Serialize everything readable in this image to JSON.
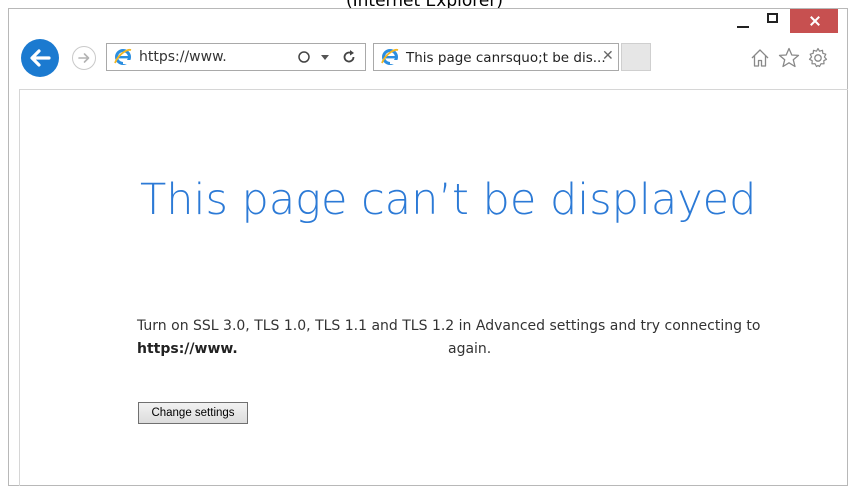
{
  "caption": "(Internet Explorer)",
  "toolbar": {
    "address_url": "https://www.",
    "tab_title": "This page canrsquo;t be dis...",
    "tab_close_glyph": "✕"
  },
  "page": {
    "heading": "This page can’t be displayed",
    "message_line1": "Turn on SSL 3.0, TLS 1.0, TLS 1.1 and TLS 1.2 in Advanced settings and try connecting to",
    "message_url": "https://www.",
    "message_line2_suffix": "again.",
    "settings_button_label": "Change settings"
  },
  "colors": {
    "accent": "#1b7ad0",
    "heading": "#2c7ad6",
    "close_button": "#c75050"
  },
  "icons": [
    "back-arrow-icon",
    "forward-arrow-icon",
    "ie-logo-icon",
    "search-icon",
    "dropdown-icon",
    "refresh-icon",
    "home-icon",
    "favorites-star-icon",
    "gear-icon"
  ]
}
